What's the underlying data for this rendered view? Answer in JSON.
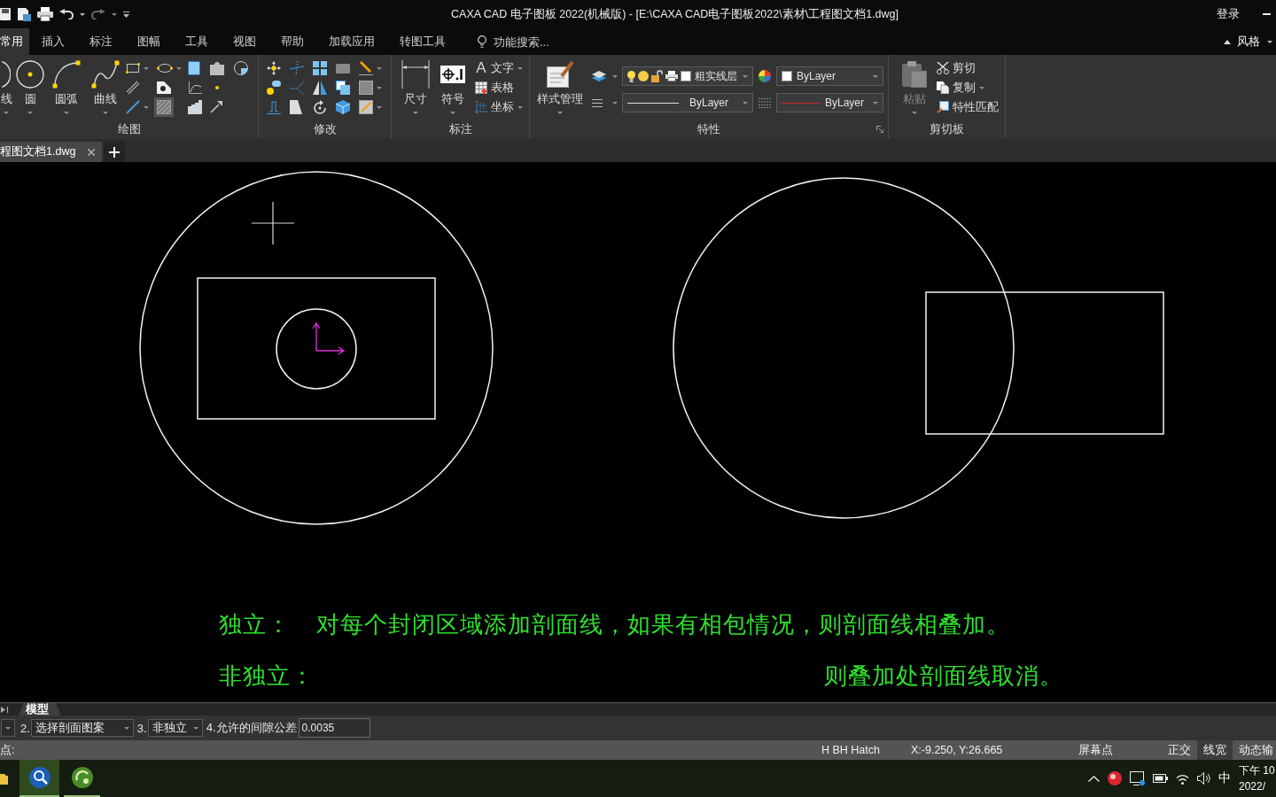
{
  "window": {
    "title": "CAXA CAD 电子图板 2022(机械版) - [E:\\CAXA CAD电子图板2022\\素材\\工程图文档1.dwg]",
    "login": "登录"
  },
  "quick_access": {
    "undo": {
      "disabled": false
    },
    "redo": {
      "disabled": true
    }
  },
  "menu_tabs": [
    {
      "label": "常用",
      "selected": true
    },
    {
      "label": "插入",
      "selected": false
    },
    {
      "label": "标注",
      "selected": false
    },
    {
      "label": "图幅",
      "selected": false
    },
    {
      "label": "工具",
      "selected": false
    },
    {
      "label": "视图",
      "selected": false
    },
    {
      "label": "帮助",
      "selected": false
    },
    {
      "label": "加载应用",
      "selected": false
    },
    {
      "label": "转图工具",
      "selected": false
    }
  ],
  "feature_search": {
    "placeholder": "功能搜索..."
  },
  "style_menu": {
    "label": "风格"
  },
  "ribbon": {
    "draw": {
      "title": "绘图",
      "large_buttons": [
        {
          "label": "线"
        },
        {
          "label": "圆"
        },
        {
          "label": "圆弧"
        },
        {
          "label": "曲线"
        }
      ],
      "tool_rows": [
        [
          {
            "dropdown": true,
            "active": false
          },
          {
            "dropdown": true,
            "active": false
          },
          {
            "dropdown": false,
            "active": false
          },
          {
            "dropdown": false,
            "active": false
          },
          {
            "dropdown": false,
            "active": false
          }
        ],
        [
          {
            "dropdown": false,
            "active": false
          },
          {
            "dropdown": false,
            "active": false
          },
          {
            "dropdown": false,
            "active": false
          },
          {
            "dropdown": false,
            "active": false
          }
        ],
        [
          {
            "dropdown": true,
            "active": false
          },
          {
            "dropdown": false,
            "active": true
          },
          {
            "dropdown": false,
            "active": false
          },
          {
            "dropdown": false,
            "active": false
          }
        ]
      ]
    },
    "modify": {
      "title": "修改",
      "tool_rows": [
        [
          {
            "dropdown": false
          },
          {
            "dropdown": false
          },
          {
            "dropdown": false
          },
          {
            "dropdown": false
          },
          {
            "dropdown": true
          }
        ],
        [
          {
            "dropdown": false
          },
          {
            "dropdown": false
          },
          {
            "dropdown": false
          },
          {
            "dropdown": false
          },
          {
            "dropdown": true
          }
        ],
        [
          {
            "dropdown": false
          },
          {
            "dropdown": false
          },
          {
            "dropdown": false
          },
          {
            "dropdown": false
          },
          {
            "dropdown": true
          }
        ]
      ]
    },
    "annotate": {
      "title": "标注",
      "large_buttons": [
        {
          "label": "尺寸"
        },
        {
          "label": "符号"
        }
      ],
      "small_buttons": [
        {
          "glyph": "A",
          "label": "文字",
          "dropdown": true
        },
        {
          "label": "表格",
          "dropdown": false
        },
        {
          "label": "坐标",
          "dropdown": true
        }
      ]
    },
    "properties": {
      "title": "特性",
      "style_button": {
        "label": "样式管理"
      },
      "layer": {
        "value": "粗实线层",
        "on": true,
        "frozen": false,
        "locked": false
      },
      "color": {
        "value": "ByLayer"
      },
      "linetype": {
        "value": "ByLayer"
      },
      "lineweight": {
        "value": "ByLayer"
      }
    },
    "clipboard": {
      "title": "剪切板",
      "paste": {
        "label": "粘贴",
        "disabled": true
      },
      "small_buttons": [
        {
          "label": "剪切",
          "dropdown": false
        },
        {
          "label": "复制",
          "dropdown": true
        },
        {
          "label": "特性匹配",
          "dropdown": false
        }
      ]
    }
  },
  "document_tabs": [
    {
      "label": "程图文档1.dwg",
      "selected": true
    }
  ],
  "canvas": {
    "notes": [
      {
        "term": "独立：",
        "text": "对每个封闭区域添加剖面线，如果有相包情况，则剖面线相叠加。"
      },
      {
        "term": "非独立：",
        "text": "则叠加处剖面线取消。"
      }
    ]
  },
  "layout_tabs": [
    {
      "label": "模型",
      "selected": true
    }
  ],
  "command_options": [
    {
      "kind": "dropdown",
      "label": "2.",
      "value": "选择剖面图案"
    },
    {
      "kind": "dropdown",
      "label": "3.",
      "value": "非独立"
    },
    {
      "kind": "input",
      "label": "4.允许的间隙公差",
      "value": "0.0035"
    }
  ],
  "status_bar": {
    "prompt": "点:",
    "command": "H BH Hatch",
    "coordinates": "X:-9.250, Y:26.665",
    "snap_mode": "屏幕点",
    "toggles": [
      {
        "label": "正交",
        "on": false
      },
      {
        "label": "线宽",
        "on": true
      },
      {
        "label": "动态输",
        "on": false
      }
    ]
  },
  "taskbar": {
    "apps": [
      {
        "selected": true
      },
      {
        "selected": false
      }
    ],
    "ime": "中",
    "time": "下午 10",
    "date": "2022/"
  }
}
